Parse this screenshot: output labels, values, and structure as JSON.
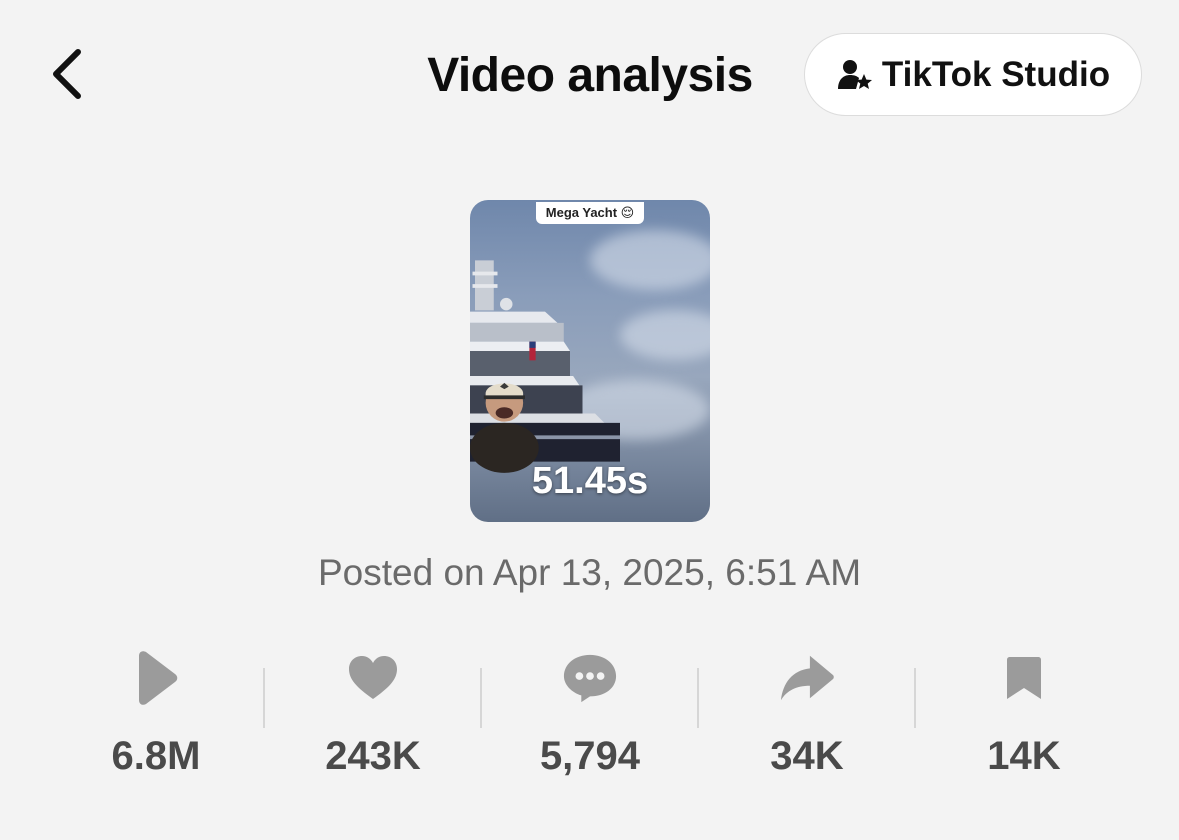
{
  "header": {
    "title": "Video analysis",
    "studio_button": "TikTok Studio"
  },
  "video": {
    "caption": "Mega Yacht 😌",
    "duration": "51.45s",
    "posted": "Posted on Apr 13, 2025, 6:51 AM"
  },
  "stats": [
    {
      "icon": "play-icon",
      "value": "6.8M"
    },
    {
      "icon": "heart-icon",
      "value": "243K"
    },
    {
      "icon": "comment-icon",
      "value": "5,794"
    },
    {
      "icon": "share-icon",
      "value": "34K"
    },
    {
      "icon": "bookmark-icon",
      "value": "14K"
    }
  ],
  "colors": {
    "background": "#f3f3f3",
    "stat_icon": "#9b9b9b",
    "stat_text": "#4a4a4a"
  }
}
